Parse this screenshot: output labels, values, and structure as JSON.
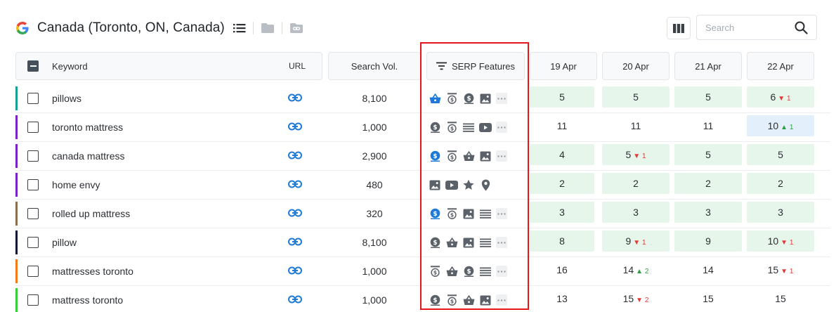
{
  "header": {
    "title": "Canada (Toronto, ON, Canada)",
    "search_placeholder": "Search"
  },
  "columns": {
    "keyword": "Keyword",
    "url": "URL",
    "volume": "Search Vol.",
    "serp": "SERP Features",
    "dates": [
      "19 Apr",
      "20 Apr",
      "21 Apr",
      "22 Apr"
    ]
  },
  "colors": {
    "accent_blue": "#1e7ad6",
    "icon_gray": "#5b6168",
    "highlight": "#e8141c",
    "rank_green_bg": "#e7f6ea",
    "rank_blue_bg": "#e3f0fb"
  },
  "rows": [
    {
      "keyword": "pillows",
      "bar": "#17a194",
      "volume": "8,100",
      "serp": [
        {
          "icon": "basket-icon",
          "active": true
        },
        {
          "icon": "top-ads-icon",
          "active": false
        },
        {
          "icon": "dollar-icon",
          "active": false
        },
        {
          "icon": "image-icon",
          "active": false
        },
        {
          "icon": "more-icon",
          "active": false
        }
      ],
      "ranks": [
        {
          "v": "5",
          "bg": "green"
        },
        {
          "v": "5",
          "bg": "green"
        },
        {
          "v": "5",
          "bg": "green"
        },
        {
          "v": "6",
          "bg": "green",
          "d": "1",
          "dir": "down"
        }
      ]
    },
    {
      "keyword": "toronto mattress",
      "bar": "#7b22c9",
      "volume": "1,000",
      "serp": [
        {
          "icon": "dollar-icon",
          "active": false
        },
        {
          "icon": "top-ads-icon",
          "active": false
        },
        {
          "icon": "list-icon",
          "active": false
        },
        {
          "icon": "video-icon",
          "active": false
        },
        {
          "icon": "more-icon",
          "active": false
        }
      ],
      "ranks": [
        {
          "v": "11",
          "bg": ""
        },
        {
          "v": "11",
          "bg": ""
        },
        {
          "v": "11",
          "bg": ""
        },
        {
          "v": "10",
          "bg": "blue",
          "d": "1",
          "dir": "up"
        }
      ]
    },
    {
      "keyword": "canada mattress",
      "bar": "#7b22c9",
      "volume": "2,900",
      "serp": [
        {
          "icon": "dollar-icon",
          "active": true
        },
        {
          "icon": "top-ads-icon",
          "active": false
        },
        {
          "icon": "basket-icon",
          "active": false
        },
        {
          "icon": "image-icon",
          "active": false
        },
        {
          "icon": "more-icon",
          "active": false
        }
      ],
      "ranks": [
        {
          "v": "4",
          "bg": "green"
        },
        {
          "v": "5",
          "bg": "green",
          "d": "1",
          "dir": "down"
        },
        {
          "v": "5",
          "bg": "green"
        },
        {
          "v": "5",
          "bg": "green"
        }
      ]
    },
    {
      "keyword": "home envy",
      "bar": "#7b22c9",
      "volume": "480",
      "serp": [
        {
          "icon": "image-icon",
          "active": false
        },
        {
          "icon": "video-icon",
          "active": false
        },
        {
          "icon": "star-icon",
          "active": false
        },
        {
          "icon": "pin-icon",
          "active": false
        }
      ],
      "ranks": [
        {
          "v": "2",
          "bg": "green"
        },
        {
          "v": "2",
          "bg": "green"
        },
        {
          "v": "2",
          "bg": "green"
        },
        {
          "v": "2",
          "bg": "green"
        }
      ]
    },
    {
      "keyword": "rolled up mattress",
      "bar": "#8a6d4d",
      "volume": "320",
      "serp": [
        {
          "icon": "dollar-icon",
          "active": true
        },
        {
          "icon": "top-ads-icon",
          "active": false
        },
        {
          "icon": "image-icon",
          "active": false
        },
        {
          "icon": "list-icon",
          "active": false
        },
        {
          "icon": "more-icon",
          "active": false
        }
      ],
      "ranks": [
        {
          "v": "3",
          "bg": "green"
        },
        {
          "v": "3",
          "bg": "green"
        },
        {
          "v": "3",
          "bg": "green"
        },
        {
          "v": "3",
          "bg": "green"
        }
      ]
    },
    {
      "keyword": "pillow",
      "bar": "#0d1233",
      "volume": "8,100",
      "serp": [
        {
          "icon": "dollar-icon",
          "active": false
        },
        {
          "icon": "basket-icon",
          "active": false
        },
        {
          "icon": "image-icon",
          "active": false
        },
        {
          "icon": "list-icon",
          "active": false
        },
        {
          "icon": "more-icon",
          "active": false
        }
      ],
      "ranks": [
        {
          "v": "8",
          "bg": "green"
        },
        {
          "v": "9",
          "bg": "green",
          "d": "1",
          "dir": "down"
        },
        {
          "v": "9",
          "bg": "green"
        },
        {
          "v": "10",
          "bg": "green",
          "d": "1",
          "dir": "down"
        }
      ]
    },
    {
      "keyword": "mattresses toronto",
      "bar": "#f07c1a",
      "volume": "1,000",
      "serp": [
        {
          "icon": "top-ads-icon",
          "active": false
        },
        {
          "icon": "basket-icon",
          "active": false
        },
        {
          "icon": "dollar-icon",
          "active": false
        },
        {
          "icon": "list-icon",
          "active": false
        },
        {
          "icon": "more-icon",
          "active": false
        }
      ],
      "ranks": [
        {
          "v": "16",
          "bg": ""
        },
        {
          "v": "14",
          "bg": "",
          "d": "2",
          "dir": "up"
        },
        {
          "v": "14",
          "bg": ""
        },
        {
          "v": "15",
          "bg": "",
          "d": "1",
          "dir": "down"
        }
      ]
    },
    {
      "keyword": "mattress toronto",
      "bar": "#3bd03b",
      "volume": "1,000",
      "serp": [
        {
          "icon": "dollar-icon",
          "active": false
        },
        {
          "icon": "top-ads-icon",
          "active": false
        },
        {
          "icon": "basket-icon",
          "active": false
        },
        {
          "icon": "image-icon",
          "active": false
        },
        {
          "icon": "more-icon",
          "active": false
        }
      ],
      "ranks": [
        {
          "v": "13",
          "bg": ""
        },
        {
          "v": "15",
          "bg": "",
          "d": "2",
          "dir": "down"
        },
        {
          "v": "15",
          "bg": ""
        },
        {
          "v": "15",
          "bg": ""
        }
      ]
    }
  ]
}
